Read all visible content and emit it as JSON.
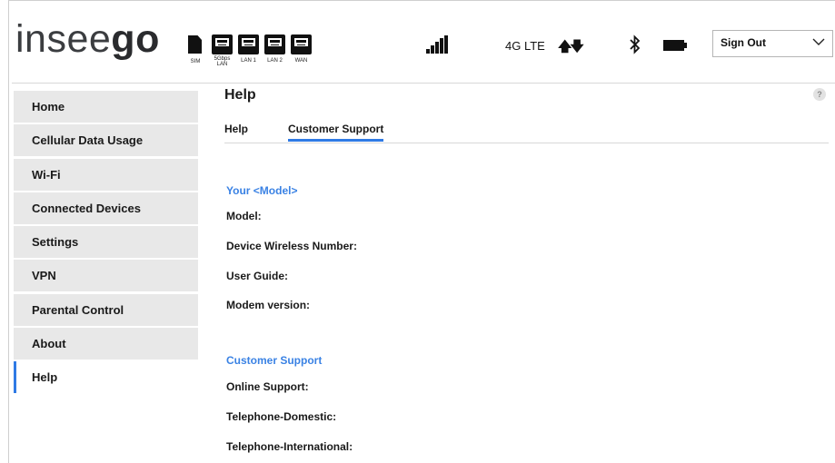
{
  "header": {
    "logo_light": "insee",
    "logo_bold": "go",
    "sim_label": "SIM",
    "ports": [
      {
        "label": "5Gbps\nLAN",
        "name": "port-5gbps-lan"
      },
      {
        "label": "LAN 1",
        "name": "port-lan-1"
      },
      {
        "label": "LAN 2",
        "name": "port-lan-2"
      },
      {
        "label": "WAN",
        "name": "port-wan"
      }
    ],
    "network_type": "4G LTE",
    "signout_label": "Sign Out"
  },
  "sidebar": {
    "items": [
      {
        "label": "Home",
        "active": false
      },
      {
        "label": "Cellular Data Usage",
        "active": false
      },
      {
        "label": "Wi-Fi",
        "active": false
      },
      {
        "label": "Connected Devices",
        "active": false
      },
      {
        "label": "Settings",
        "active": false
      },
      {
        "label": "VPN",
        "active": false
      },
      {
        "label": "Parental Control",
        "active": false
      },
      {
        "label": "About",
        "active": false
      },
      {
        "label": "Help",
        "active": true
      }
    ]
  },
  "main": {
    "title": "Help",
    "help_icon": "?",
    "tabs": [
      {
        "label": "Help"
      },
      {
        "label": "Customer Support"
      }
    ],
    "sections": [
      {
        "heading": "Your <Model>",
        "fields": [
          "Model:",
          "Device Wireless Number:",
          "User Guide:",
          "Modem version:"
        ]
      },
      {
        "heading": "Customer Support",
        "fields": [
          "Online Support:",
          "Telephone-Domestic:",
          "Telephone-International:"
        ]
      }
    ]
  },
  "colors": {
    "accent": "#2f7ae5",
    "section_heading": "#3a82e4",
    "nav_bg": "#e8e8e8"
  }
}
